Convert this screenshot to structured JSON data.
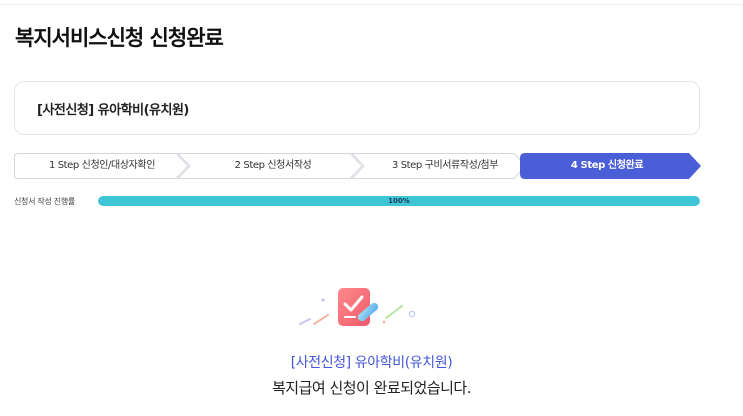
{
  "page": {
    "title": "복지서비스신청 신청완료"
  },
  "service": {
    "name": "[사전신청] 유아학비(유치원)"
  },
  "steps": [
    {
      "label": "1 Step 신청인/대상자확인",
      "active": false
    },
    {
      "label": "2 Step 신청서작성",
      "active": false
    },
    {
      "label": "3 Step 구비서류작성/첨부",
      "active": false
    },
    {
      "label": "4 Step 신청완료",
      "active": true
    }
  ],
  "progress": {
    "label": "신청서 작성 진행률",
    "percent_text": "100%",
    "value": 100
  },
  "completion": {
    "service_name": "[사전신청] 유아학비(유치원)",
    "message": "복지급여 신청이 완료되었습니다."
  },
  "colors": {
    "active_step": "#4a5ed8",
    "progress_fill": "#3ec6d6",
    "completion_title": "#4457d9"
  },
  "icons": {
    "completion": "checked-document-with-pen-icon"
  }
}
